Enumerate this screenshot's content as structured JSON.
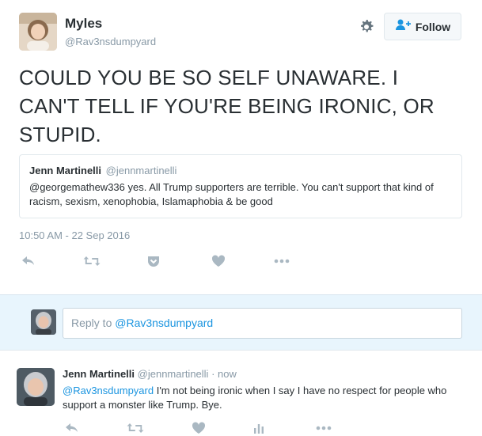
{
  "tweet": {
    "display_name": "Myles",
    "screen_name": "@Rav3nsdumpyard",
    "text": "COULD YOU BE SO SELF UNAWARE. I CAN'T TELL IF YOU'RE BEING IRONIC, OR STUPID.",
    "timestamp": "10:50 AM - 22 Sep 2016",
    "follow_label": "Follow"
  },
  "quote": {
    "name": "Jenn Martinelli",
    "handle": "@jennmartinelli",
    "text": "@georgemathew336 yes. All Trump supporters are terrible. You can't support that kind of racism, sexism, xenophobia, Islamaphobia & be good"
  },
  "reply_box": {
    "prefix": "Reply to ",
    "mention": "@Rav3nsdumpyard"
  },
  "reply": {
    "name": "Jenn Martinelli",
    "handle": "@jennmartinelli",
    "sep": " · ",
    "time": "now",
    "mention": "@Rav3nsdumpyard",
    "text": " I'm not being ironic when I say I have no respect for people who support a monster like Trump. Bye."
  },
  "icons": [
    "gear-icon",
    "follow-person-icon",
    "reply-icon",
    "retweet-icon",
    "pocket-icon",
    "like-icon",
    "more-icon",
    "analytics-icon"
  ],
  "colors": {
    "accent": "#1b95e0",
    "muted": "#8899a6",
    "text": "#292f33",
    "reply_bg": "#e8f5fd"
  }
}
